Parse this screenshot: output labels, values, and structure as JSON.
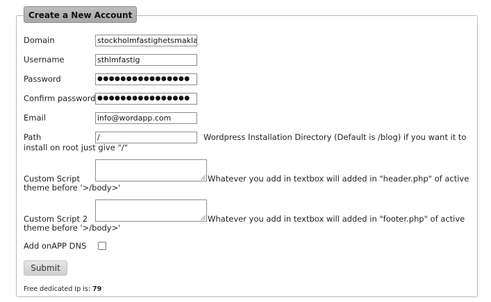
{
  "form": {
    "legend": "Create a New Account",
    "domain": {
      "label": "Domain",
      "value": "stockholmfastighetsmakla"
    },
    "username": {
      "label": "Username",
      "value": "sthlmfastig"
    },
    "password": {
      "label": "Password",
      "value": "●●●●●●●●●●●●●●●●"
    },
    "confirm_password": {
      "label": "Confirm password",
      "value": "●●●●●●●●●●●●●●●●"
    },
    "email": {
      "label": "Email",
      "value": "info@wordapp.com"
    },
    "path": {
      "label": "Path",
      "value": "/",
      "note_line1": "Wordpress Installation Directory (Default is /blog) if you want it to",
      "note_line2": "install on root just give \"/\""
    },
    "custom_script": {
      "label": "Custom Script",
      "note": "Whatever you add in textbox will added in \"header.php\" of active",
      "note_line2": "theme before '>/body>'"
    },
    "custom_script_2": {
      "label": "Custom Script 2",
      "note": "Whatever you add in textbox will added in \"footer.php\" of active",
      "note_line2": "theme before '>/body>'"
    },
    "add_onapp_dns": {
      "label": "Add onAPP DNS",
      "checked": false
    },
    "submit_label": "Submit",
    "free_ip_label": "Free dedicated Ip is:",
    "free_ip_value": "79"
  }
}
